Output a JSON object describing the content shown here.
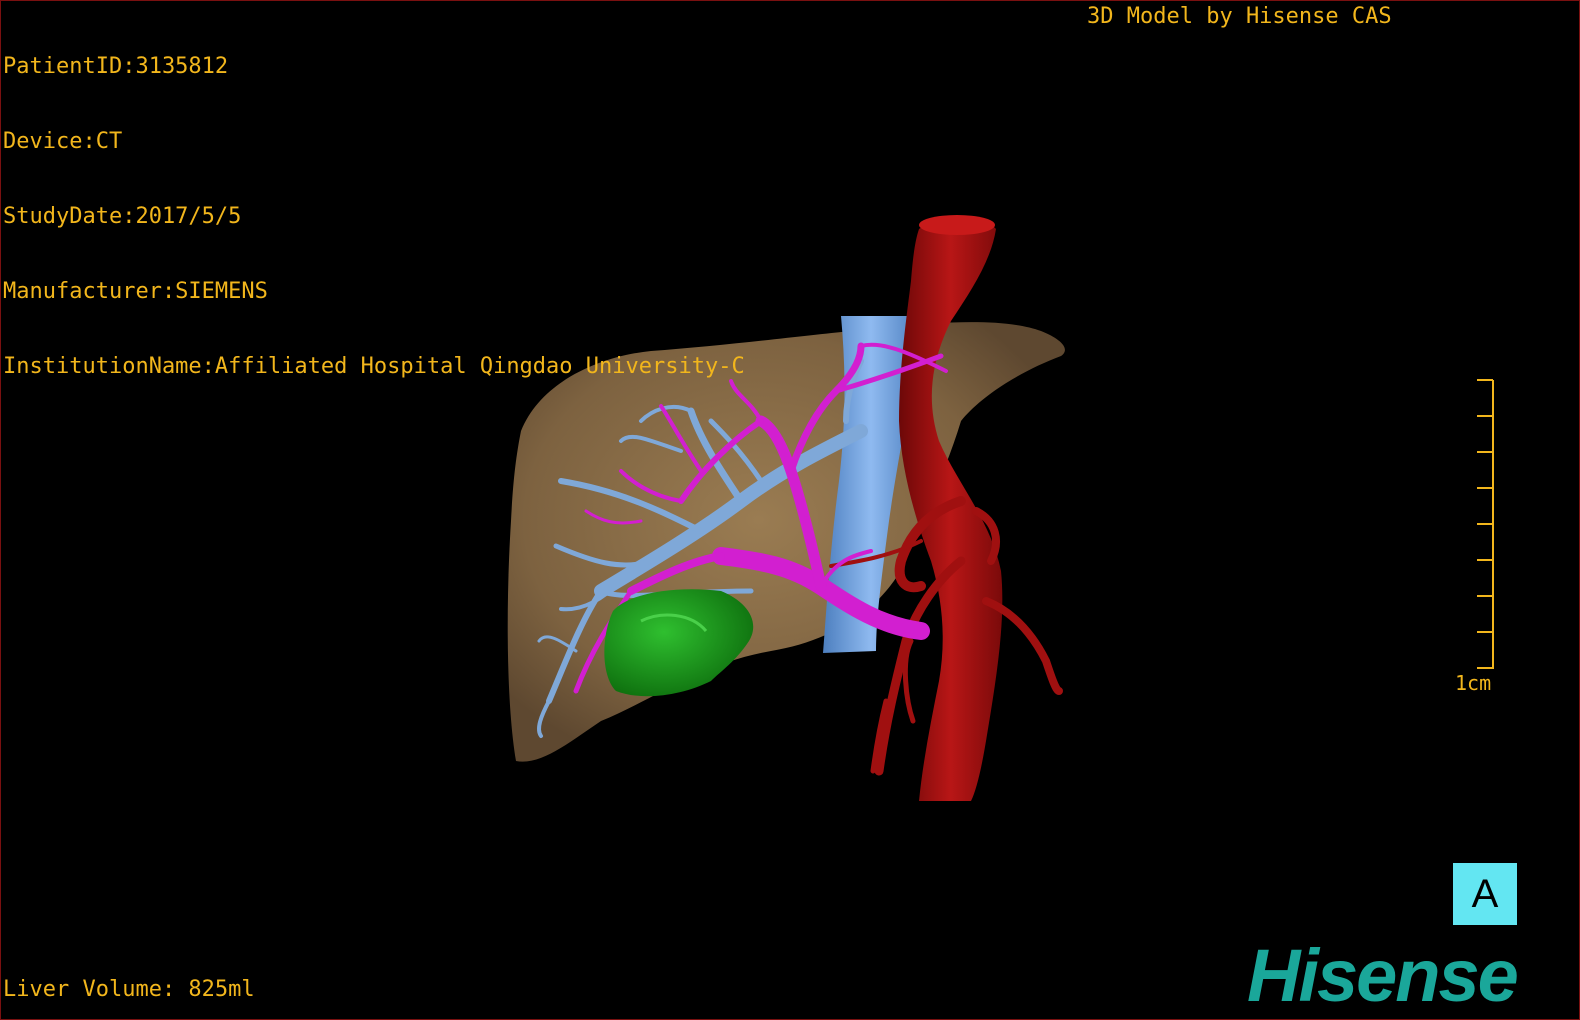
{
  "header": {
    "patient_id": "PatientID:3135812",
    "device": "Device:CT",
    "study_date": "StudyDate:2017/5/5",
    "manufacturer": "Manufacturer:SIEMENS",
    "institution": "InstitutionName:Affiliated Hospital Qingdao University-C",
    "credit": "3D Model by Hisense CAS"
  },
  "footer": {
    "liver_volume": "Liver Volume: 825ml"
  },
  "scale": {
    "label": "1cm"
  },
  "view": {
    "orientation": "A"
  },
  "brand": {
    "logo_text": "Hisense",
    "color": "#1aa79a"
  },
  "colors": {
    "overlay_text": "#f2b61c",
    "liver": "#8a6b43",
    "aorta": "#b01313",
    "vena_cava": "#6fa2dc",
    "portal_vein": "#d21fd0",
    "hepatic_vein": "#7fa8d8",
    "lesion": "#1a9a1a",
    "badge": "#63e6f2"
  }
}
